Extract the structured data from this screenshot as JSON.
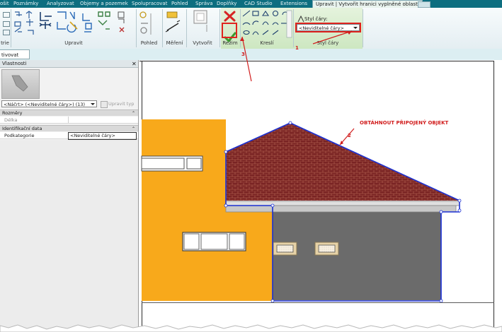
{
  "tabs": [
    {
      "label": "ošit",
      "active": false
    },
    {
      "label": "Poznámky",
      "active": false
    },
    {
      "label": "Analyzovat",
      "active": false
    },
    {
      "label": "Objemy a pozemek",
      "active": false
    },
    {
      "label": "Spolupracovat",
      "active": false
    },
    {
      "label": "Pohled",
      "active": false
    },
    {
      "label": "Správa",
      "active": false
    },
    {
      "label": "Doplňky",
      "active": false
    },
    {
      "label": "CAD Studio",
      "active": false
    },
    {
      "label": "Extensions",
      "active": false
    },
    {
      "label": "Upravit | Vytvořit hranici vyplněné oblasti",
      "active": true
    }
  ],
  "ribbon": {
    "panels": {
      "left_cut": "trie",
      "modify": "Upravit",
      "view": "Pohled",
      "measure": "Měření",
      "create": "Vytvořit",
      "mode": "Režim",
      "draw": "Kreslí",
      "line_style": "Styl čáry"
    },
    "line_style_label": "Styl čáry:",
    "line_style_value": "<Neviditelné čáry>"
  },
  "options_bar": {
    "tab_label": "tivovat kóty"
  },
  "properties": {
    "title": "Vlastnosti",
    "type_selector": "<Náčrt> (<Neviditelné čáry>) (13)",
    "edit_type": "Upravit typ",
    "groups": [
      {
        "label": "Rozměry",
        "rows": [
          {
            "key": "Délka",
            "value": ""
          }
        ]
      },
      {
        "label": "Identifikační data",
        "rows": [
          {
            "key": "Podkategorie",
            "value": "<Neviditelné čáry>"
          }
        ]
      }
    ]
  },
  "annotations": {
    "trace": "OBTÁHNOUT PŘIPOJENÝ OBJEKT",
    "n1": "1",
    "n2": "2",
    "n3": "3"
  },
  "colors": {
    "tab_bar": "#0d6e80",
    "accent_red": "#e0231f",
    "wall_orange": "#f8a91b",
    "wall_gray": "#6b6b6b",
    "roof_brick": "#7a2424",
    "sketch_blue": "#1a2fd3",
    "confirm_green": "#3a9a2e"
  },
  "icons": {
    "cancel": "red-x-icon",
    "finish": "green-check-icon",
    "close_palette": "close-icon"
  }
}
